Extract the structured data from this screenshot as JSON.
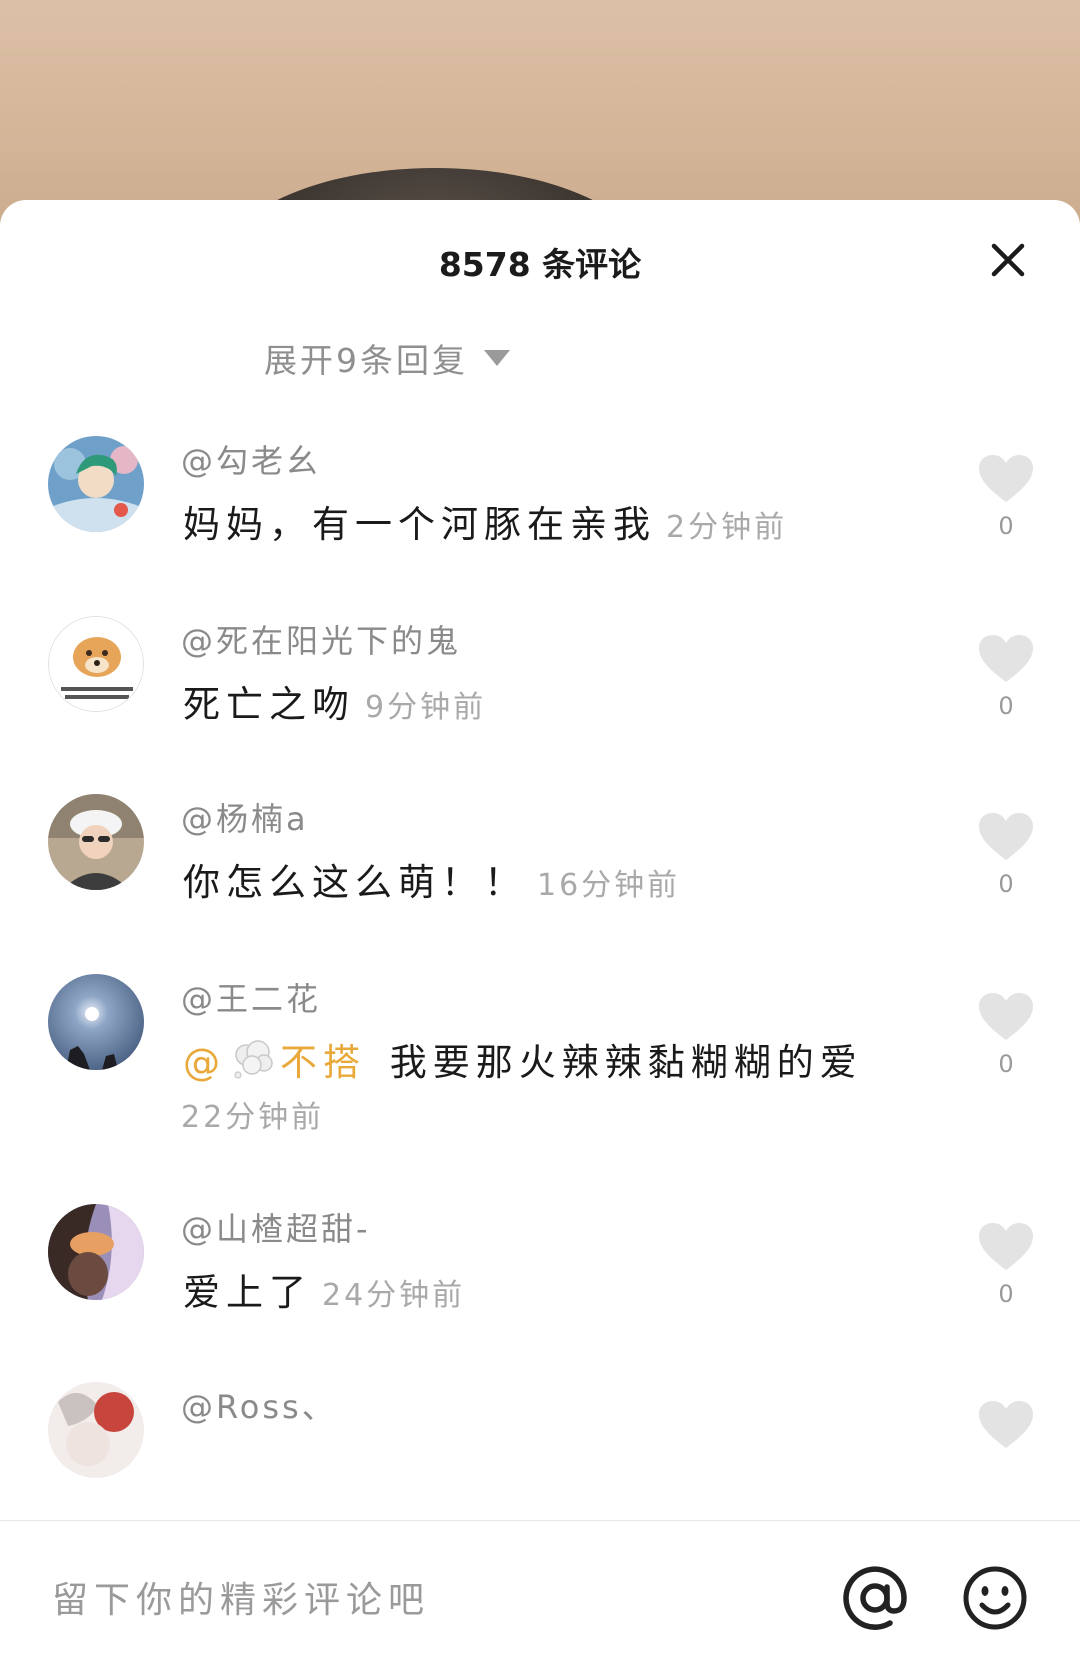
{
  "header": {
    "title": "8578 条评论",
    "close_icon": "close-icon"
  },
  "expand": {
    "label": "展开9条回复",
    "icon": "triangle-down-icon"
  },
  "comments": [
    {
      "username": "@勾老幺",
      "text": "妈妈，有一个河豚在亲我",
      "time": "2分钟前",
      "likes": "0"
    },
    {
      "username": "@死在阳光下的鬼",
      "text": "死亡之吻",
      "time": "9分钟前",
      "likes": "0"
    },
    {
      "username": "@杨楠a",
      "text": "你怎么这么萌！！",
      "time": "16分钟前",
      "likes": "0"
    },
    {
      "username": "@王二花",
      "mention_prefix": "@",
      "mention_name": "不搭",
      "mention_emoji": "thought-balloon-icon",
      "text": "我要那火辣辣黏糊糊的爱",
      "time": "22分钟前",
      "likes": "0"
    },
    {
      "username": "@山楂超甜-",
      "text": "爱上了",
      "time": "24分钟前",
      "likes": "0"
    },
    {
      "username": "@Ross、"
    }
  ],
  "composer": {
    "placeholder": "留下你的精彩评论吧",
    "at_icon": "at-icon",
    "emoji_icon": "smiley-icon"
  },
  "colors": {
    "mention": "#e8a93a",
    "secondary_text": "#8a8a8a",
    "like_heart": "#e3e3e3"
  }
}
